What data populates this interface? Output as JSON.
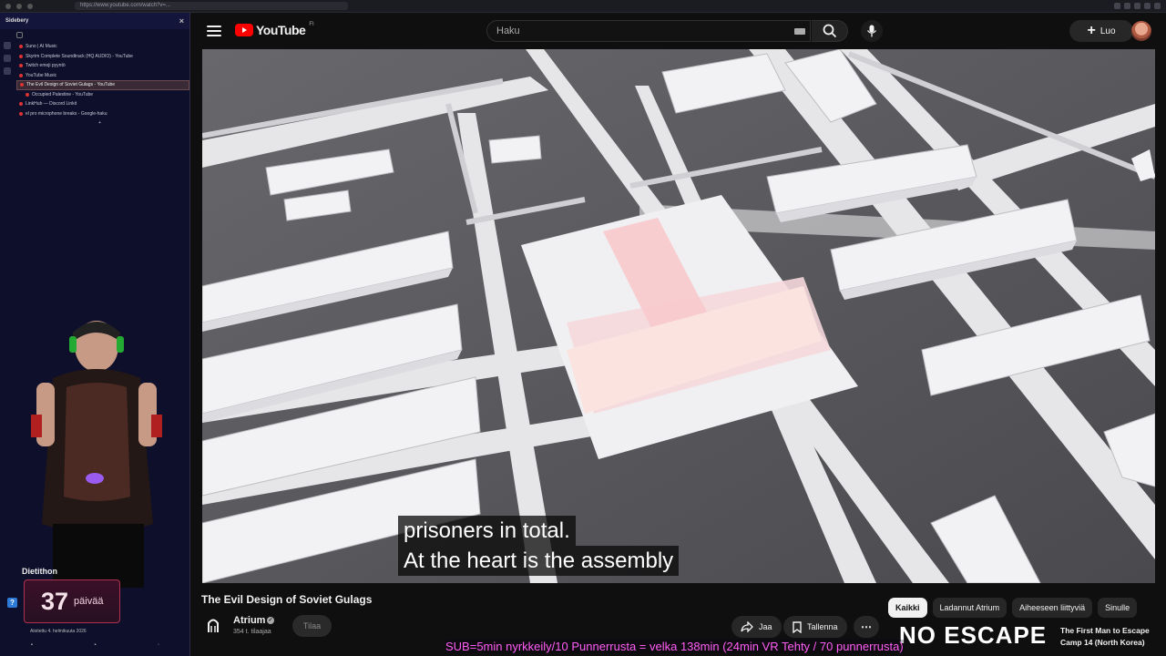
{
  "browser": {
    "url": "https://www.youtube.com/watch?v=..."
  },
  "sidebery": {
    "title": "Sidebery",
    "close": "×",
    "tabs": [
      {
        "label": "Suno | AI Music",
        "child": false,
        "active": false
      },
      {
        "label": "Skyrim Complete Soundtrack (HQ AUDIO) - YouTube",
        "child": false,
        "active": false
      },
      {
        "label": "Twitch emoji pyyntö",
        "child": false,
        "active": false
      },
      {
        "label": "YouTube Music",
        "child": false,
        "active": false
      },
      {
        "label": "The Evil Design of Soviet Gulags - YouTube",
        "child": false,
        "active": true
      },
      {
        "label": "Occupied Palestine - YouTube",
        "child": true,
        "active": false
      },
      {
        "label": "LinkHub — Discord Linkit",
        "child": false,
        "active": false
      },
      {
        "label": "el pro microphone breaks - Google-haku",
        "child": false,
        "active": false
      }
    ],
    "add_tab": "+"
  },
  "overlay": {
    "streak_label": "Dietithon",
    "streak_number": "37",
    "streak_unit": "päivää",
    "streak_since": "Aloitettu 4. helmikuuta 2026",
    "help_icon": "?",
    "ticker": "SUB=5min nyrkkeily/10 Punnerrusta = velka 138min (24min VR Tehty / 70 punnerrusta)"
  },
  "header": {
    "logo_text": "YouTube",
    "country": "FI",
    "search_placeholder": "Haku",
    "create_label": "Luo",
    "accent": "#ff0000"
  },
  "video": {
    "subtitle_line1": "prisoners in total.",
    "subtitle_line2": "At the heart is the assembly"
  },
  "meta": {
    "title": "The Evil Design of Soviet Gulags",
    "channel": "Atrium",
    "subscribers": "354 t. tilaajaa",
    "subscribe_label": "Tilaa",
    "share_label": "Jaa",
    "save_label": "Tallenna",
    "more_label": "⋯"
  },
  "chips": [
    "Kaikki",
    "Ladannut Atrium",
    "Aiheeseen liittyviä",
    "Sinulle"
  ],
  "recommendation": {
    "thumb_text": "NO ESCAPE",
    "title": "The First Man to Escape Camp 14 (North Korea)"
  }
}
